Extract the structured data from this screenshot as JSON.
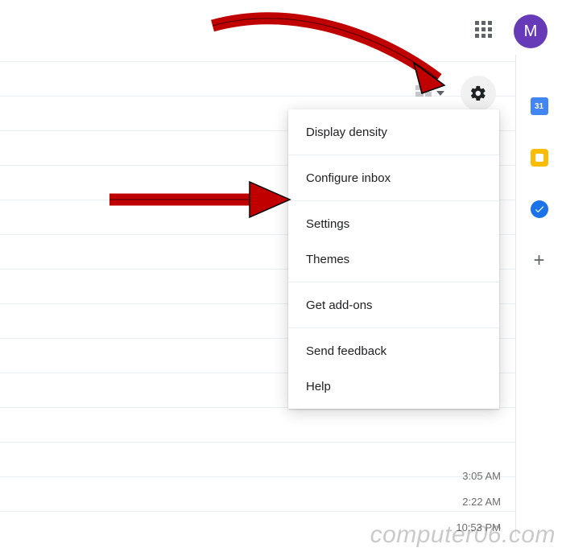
{
  "header": {
    "avatar_initial": "M"
  },
  "side": {
    "calendar_day": "31"
  },
  "dropdown": {
    "items": [
      "Display density",
      "Configure inbox",
      "Settings",
      "Themes",
      "Get add-ons",
      "Send feedback",
      "Help"
    ]
  },
  "times": [
    "3:05 AM",
    "2:22 AM",
    "10:53 PM"
  ],
  "watermark": "computer06.com"
}
